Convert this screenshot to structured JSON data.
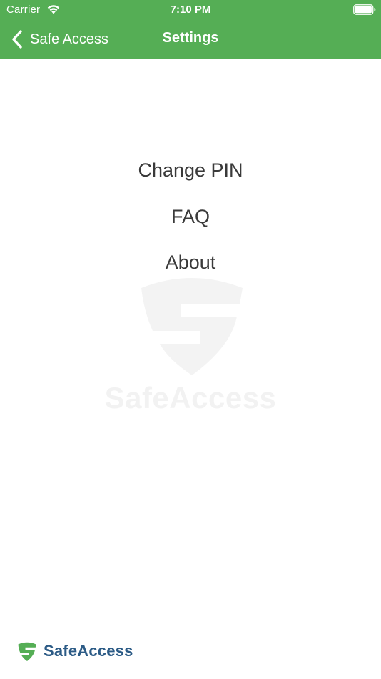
{
  "status_bar": {
    "carrier": "Carrier",
    "time": "7:10 PM",
    "icons": [
      "wifi-icon",
      "battery-icon"
    ]
  },
  "nav_bar": {
    "back_label": "Safe Access",
    "title": "Settings",
    "background_color": "#55ae55"
  },
  "menu": {
    "items": [
      {
        "label": "Change PIN"
      },
      {
        "label": "FAQ"
      },
      {
        "label": "About"
      }
    ]
  },
  "watermark": {
    "icon": "shield-icon",
    "text": "SafeAccess"
  },
  "footer": {
    "icon": "shield-icon",
    "brand": "SafeAccess",
    "brand_color": "#2c5b86",
    "icon_color": "#55ae55"
  }
}
